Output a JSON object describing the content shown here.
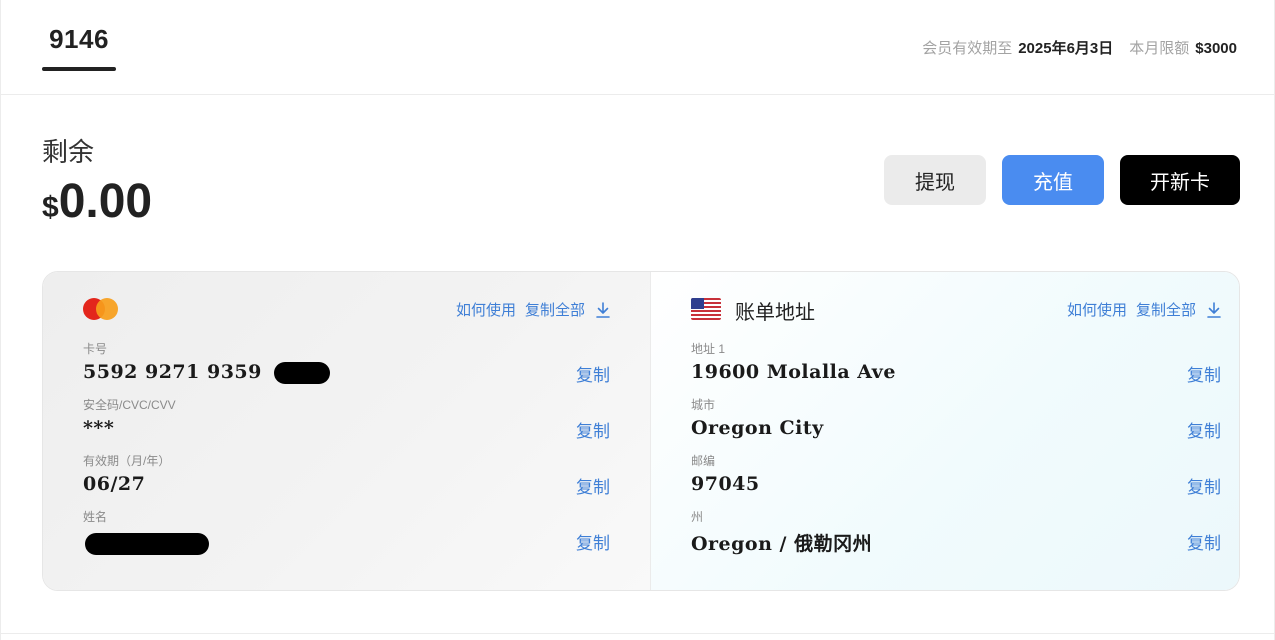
{
  "header": {
    "card_tab": "9146",
    "membership_label": "会员有效期至",
    "membership_date": "2025年6月3日",
    "monthly_limit_label": "本月限额",
    "monthly_limit_value": "$3000"
  },
  "balance": {
    "label": "剩余",
    "currency": "$",
    "amount": "0.00"
  },
  "buttons": {
    "withdraw": "提现",
    "topup": "充值",
    "new_card": "开新卡"
  },
  "card": {
    "brand_icon": "mastercard-logo",
    "how_to_use": "如何使用",
    "copy_all": "复制全部",
    "copy": "复制",
    "fields": {
      "number_label": "卡号",
      "number_value": "5592 9271 9359",
      "cvc_label": "安全码/CVC/CVV",
      "cvc_value": "***",
      "expiry_label": "有效期（月/年）",
      "expiry_value": "06/27",
      "name_label": "姓名"
    }
  },
  "billing": {
    "flag_icon": "us-flag",
    "title": "账单地址",
    "how_to_use": "如何使用",
    "copy_all": "复制全部",
    "copy": "复制",
    "fields": {
      "address_label": "地址 1",
      "address_value": "19600 Molalla Ave",
      "city_label": "城市",
      "city_value": "Oregon City",
      "zip_label": "邮编",
      "zip_value": "97045",
      "state_label": "州",
      "state_value": "Oregon / 俄勒冈州"
    }
  },
  "colors": {
    "accent": "#4a8cf0",
    "link": "#3f7fd6",
    "dark": "#000000"
  }
}
